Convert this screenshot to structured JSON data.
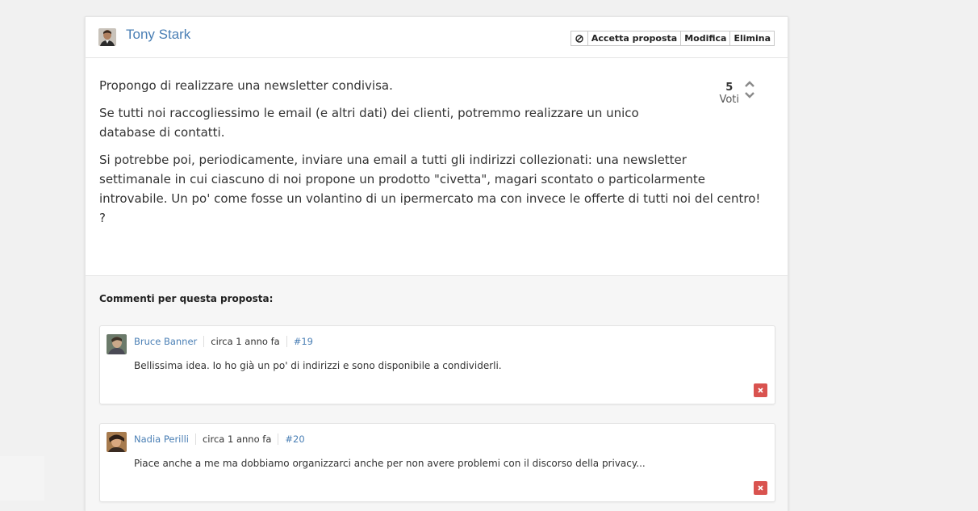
{
  "proposal": {
    "author": "Tony Stark",
    "actions": {
      "ban_icon": "ban-icon",
      "accept_label": "Accetta proposta",
      "edit_label": "Modifica",
      "delete_label": "Elimina"
    },
    "paragraphs": [
      "Propongo di realizzare una newsletter condivisa.",
      "Se tutti noi raccogliessimo le email (e altri dati) dei clienti, potremmo realizzare un unico database di contatti.",
      "Si potrebbe poi, periodicamente, inviare una email a tutti gli indirizzi collezionati: una newsletter settimanale in cui ciascuno di noi propone un prodotto \"civetta\", magari scontato o particolarmente introvabile. Un po' come fosse un volantino di un ipermercato ma con invece le offerte di tutti noi del centro! ?"
    ],
    "votes": {
      "count": "5",
      "label": "Voti"
    }
  },
  "comments": {
    "title": "Commenti per questa proposta:",
    "items": [
      {
        "author": "Bruce Banner",
        "time": "circa 1 anno fa",
        "id": "#19",
        "text": "Bellissima idea. Io ho già un po' di indirizzi e sono disponibile a condividerli."
      },
      {
        "author": "Nadia Perilli",
        "time": "circa 1 anno fa",
        "id": "#20",
        "text": "Piace anche a me ma dobbiamo organizzarci anche per non avere problemi con il discorso della privacy..."
      }
    ]
  },
  "colors": {
    "link": "#4a7fb5",
    "delete": "#d9534f",
    "background": "#f1f1f1"
  }
}
